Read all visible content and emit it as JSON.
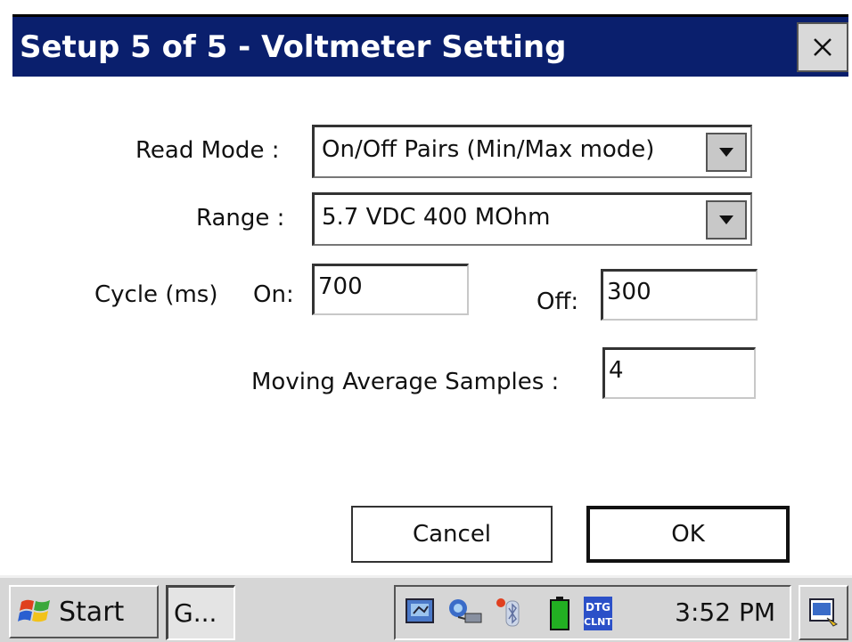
{
  "window": {
    "title": "Setup 5 of 5 - Voltmeter Setting",
    "close_icon": "close-icon"
  },
  "form": {
    "read_mode_label": "Read Mode :",
    "read_mode_value": "On/Off Pairs (Min/Max mode)",
    "range_label": "Range :",
    "range_value": "5.7 VDC 400 MOhm",
    "cycle_label": "Cycle (ms)",
    "on_label": "On:",
    "on_value": "700",
    "off_label": "Off:",
    "off_value": "300",
    "moving_avg_label": "Moving Average Samples :",
    "moving_avg_value": "4"
  },
  "buttons": {
    "cancel_label": "Cancel",
    "ok_label": "OK"
  },
  "taskbar": {
    "start_label": "Start",
    "task_label": "G...",
    "clock": "3:52 PM",
    "tray_icons": [
      "network-icon",
      "connection-icon",
      "bluetooth-icon",
      "battery-icon",
      "dtg-client-icon"
    ],
    "desktop_icon": "desktop-icon"
  },
  "colors": {
    "titlebar": "#0a1f6d",
    "taskbar": "#d6d6d6",
    "battery": "#22b022"
  }
}
